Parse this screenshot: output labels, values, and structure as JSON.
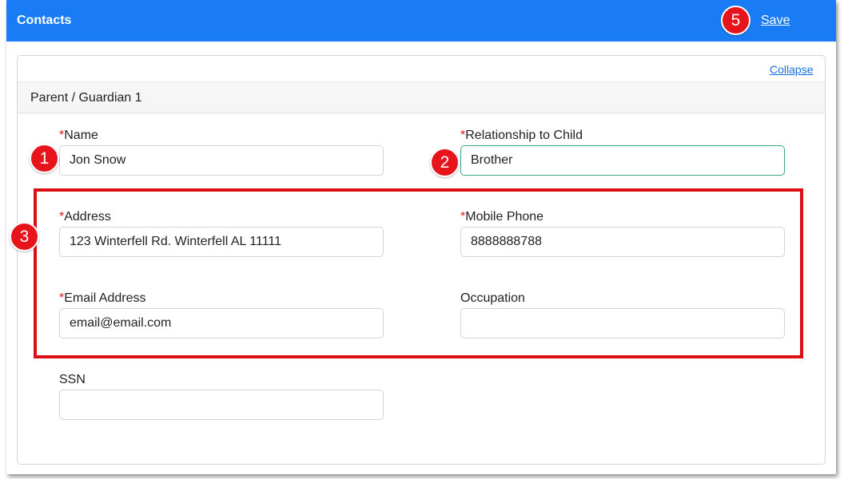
{
  "header": {
    "title": "Contacts",
    "save_label": "Save"
  },
  "card": {
    "collapse_label": "Collapse",
    "section_title": "Parent / Guardian 1"
  },
  "required_marker": "*",
  "fields": {
    "name": {
      "label": "Name",
      "value": "Jon Snow",
      "required": true
    },
    "relationship": {
      "label": "Relationship to Child",
      "value": "Brother",
      "required": true
    },
    "address": {
      "label": "Address",
      "value": "123 Winterfell Rd. Winterfell AL 11111",
      "required": true
    },
    "mobile_phone": {
      "label": "Mobile Phone",
      "value": "8888888788",
      "required": true
    },
    "email": {
      "label": "Email Address",
      "value": "email@email.com",
      "required": true
    },
    "occupation": {
      "label": "Occupation",
      "value": "",
      "required": false
    },
    "ssn": {
      "label": "SSN",
      "value": "",
      "required": false
    }
  },
  "callouts": {
    "one": "1",
    "two": "2",
    "three": "3",
    "five": "5"
  },
  "colors": {
    "topbar": "#1a7cf4",
    "callout": "#e8141b",
    "highlight_border": "#dc0f17",
    "required": "#d9191f",
    "focused_border": "#3aa58f"
  }
}
